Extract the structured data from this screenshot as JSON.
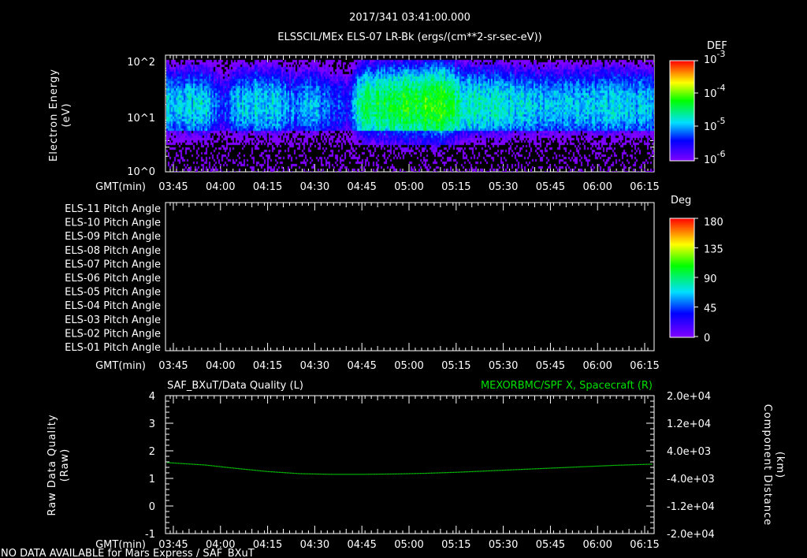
{
  "header": {
    "datetime": "2017/341 03:41:00.000"
  },
  "colors": {
    "line": "#00e000",
    "axis": "#ffffff",
    "bg": "#000000"
  },
  "chart_data": [
    {
      "type": "heatmap",
      "title": "ELSSCIL/MEx ELS-07 LR-Bk  (ergs/(cm**2-sr-sec-eV))",
      "ylabel": "Electron Energy\n(eV)",
      "ylabel_lines": [
        "Electron Energy",
        "(eV)"
      ],
      "xlabel": "GMT(min)",
      "ytick_labels": [
        "10^2",
        "10^1",
        "10^0"
      ],
      "yticks": [
        {
          "base": "10",
          "exp": "2",
          "value": 100
        },
        {
          "base": "10",
          "exp": "1",
          "value": 10
        },
        {
          "base": "10",
          "exp": "0",
          "value": 1
        }
      ],
      "ylim": [
        1,
        180
      ],
      "yscale": "log",
      "xtick_labels": [
        "03:45",
        "04:00",
        "04:15",
        "04:30",
        "04:45",
        "05:00",
        "05:15",
        "05:30",
        "05:45",
        "06:00",
        "06:15"
      ],
      "xlim_min": [
        222.5,
        378
      ],
      "colorbar": {
        "title": "DEF",
        "labels": [
          {
            "base": "10",
            "exp": "-3"
          },
          {
            "base": "10",
            "exp": "-4"
          },
          {
            "base": "10",
            "exp": "-5"
          },
          {
            "base": "10",
            "exp": "-6"
          }
        ],
        "range_log10": [
          -6.2,
          -3
        ]
      },
      "peak_energy_eV": 20,
      "intensity_profile_log10": {
        "time_min": [
          222,
          235,
          240,
          244,
          250,
          258,
          262,
          268,
          275,
          280,
          284,
          290,
          296,
          300,
          305,
          310,
          316,
          322,
          330,
          340,
          350,
          360,
          370,
          378
        ],
        "value": [
          -5.0,
          -4.9,
          -5.6,
          -5.1,
          -4.9,
          -5.0,
          -5.3,
          -5.0,
          -5.4,
          -5.6,
          -4.6,
          -4.5,
          -4.4,
          -4.4,
          -4.3,
          -4.1,
          -4.7,
          -4.8,
          -4.9,
          -5.0,
          -5.0,
          -5.0,
          -5.0,
          -5.1
        ]
      }
    },
    {
      "type": "heatmap",
      "xlabel": "GMT(min)",
      "row_labels": [
        "ELS-11 Pitch Angle",
        "ELS-10 Pitch Angle",
        "ELS-09 Pitch Angle",
        "ELS-08 Pitch Angle",
        "ELS-07 Pitch Angle",
        "ELS-06 Pitch Angle",
        "ELS-05 Pitch Angle",
        "ELS-04 Pitch Angle",
        "ELS-03 Pitch Angle",
        "ELS-02 Pitch Angle",
        "ELS-01 Pitch Angle"
      ],
      "xtick_labels": [
        "03:45",
        "04:00",
        "04:15",
        "04:30",
        "04:45",
        "05:00",
        "05:15",
        "05:30",
        "05:45",
        "06:00",
        "06:15"
      ],
      "colorbar": {
        "title": "Deg",
        "labels": [
          "180",
          "135",
          "90",
          "45",
          "0"
        ],
        "range": [
          0,
          180
        ]
      },
      "values": []
    },
    {
      "type": "line",
      "title_left": "SAF_BXuT/Data Quality (L)",
      "title_right": "MEXORBMC/SPF X, Spacecraft (R)",
      "ylabel_left_lines": [
        "Raw Data Quality",
        "(Raw)"
      ],
      "ylabel_right_lines": [
        "Component Distance",
        "(km)"
      ],
      "xlabel": "GMT(min)",
      "xtick_labels": [
        "03:45",
        "04:00",
        "04:15",
        "04:30",
        "04:45",
        "05:00",
        "05:15",
        "05:30",
        "05:45",
        "06:00",
        "06:15"
      ],
      "ylim_left": [
        -1,
        4
      ],
      "ytick_labels_left": [
        "4",
        "3",
        "2",
        "1",
        "0",
        "-1"
      ],
      "ylim_right": [
        -20000,
        20000
      ],
      "ytick_labels_right": [
        "2.0e+04",
        "1.2e+04",
        "4.0e+03",
        "-4.0e+03",
        "-1.2e+04",
        "-2.0e+04"
      ],
      "series": [
        {
          "name": "MEXORBMC/SPF X, Spacecraft",
          "axis": "right",
          "x_min": [
            223,
            235,
            245,
            255,
            265,
            275,
            285,
            295,
            305,
            315,
            325,
            335,
            345,
            355,
            365,
            377
          ],
          "y_km": [
            600,
            -100,
            -1100,
            -2000,
            -2600,
            -2800,
            -2800,
            -2700,
            -2500,
            -2200,
            -1800,
            -1400,
            -1000,
            -600,
            -200,
            150
          ]
        }
      ]
    }
  ],
  "footer": {
    "note": "NO DATA AVAILABLE for Mars Express / SAF_BXuT"
  }
}
